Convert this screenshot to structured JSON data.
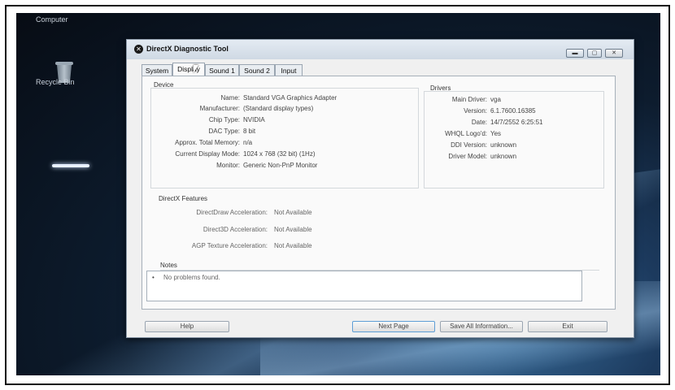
{
  "desktop": {
    "computer_label": "Computer",
    "recycle_bin_label": "Recycle Bin"
  },
  "window": {
    "title": "DirectX Diagnostic Tool",
    "tabs": [
      {
        "label": "System"
      },
      {
        "label": "Display"
      },
      {
        "label": "Sound 1"
      },
      {
        "label": "Sound 2"
      },
      {
        "label": "Input"
      }
    ],
    "active_tab": "Display"
  },
  "device": {
    "heading": "Device",
    "fields": [
      {
        "label": "Name:",
        "value": "Standard VGA Graphics Adapter"
      },
      {
        "label": "Manufacturer:",
        "value": "(Standard display types)"
      },
      {
        "label": "Chip Type:",
        "value": "NVIDIA"
      },
      {
        "label": "DAC Type:",
        "value": "8 bit"
      },
      {
        "label": "Approx. Total Memory:",
        "value": "n/a"
      },
      {
        "label": "Current Display Mode:",
        "value": "1024 x 768 (32 bit) (1Hz)"
      },
      {
        "label": "Monitor:",
        "value": "Generic Non-PnP Monitor"
      }
    ]
  },
  "drivers": {
    "heading": "Drivers",
    "fields": [
      {
        "label": "Main Driver:",
        "value": "vga"
      },
      {
        "label": "Version:",
        "value": "6.1.7600.16385"
      },
      {
        "label": "Date:",
        "value": "14/7/2552 6:25:51"
      },
      {
        "label": "WHQL Logo'd:",
        "value": "Yes"
      },
      {
        "label": "DDI Version:",
        "value": "unknown"
      },
      {
        "label": "Driver Model:",
        "value": "unknown"
      }
    ]
  },
  "features": {
    "heading": "DirectX Features",
    "fields": [
      {
        "label": "DirectDraw Acceleration:",
        "value": "Not Available"
      },
      {
        "label": "Direct3D Acceleration:",
        "value": "Not Available"
      },
      {
        "label": "AGP Texture Acceleration:",
        "value": "Not Available"
      }
    ]
  },
  "notes": {
    "heading": "Notes",
    "items": [
      "No problems found."
    ]
  },
  "buttons": {
    "help": "Help",
    "next_page": "Next Page",
    "save_all": "Save All Information...",
    "exit": "Exit"
  },
  "colors": {
    "window_bg": "#f0f0f0",
    "accent_border": "#5e9ed6",
    "desktop_dark": "#0d1c2e"
  }
}
